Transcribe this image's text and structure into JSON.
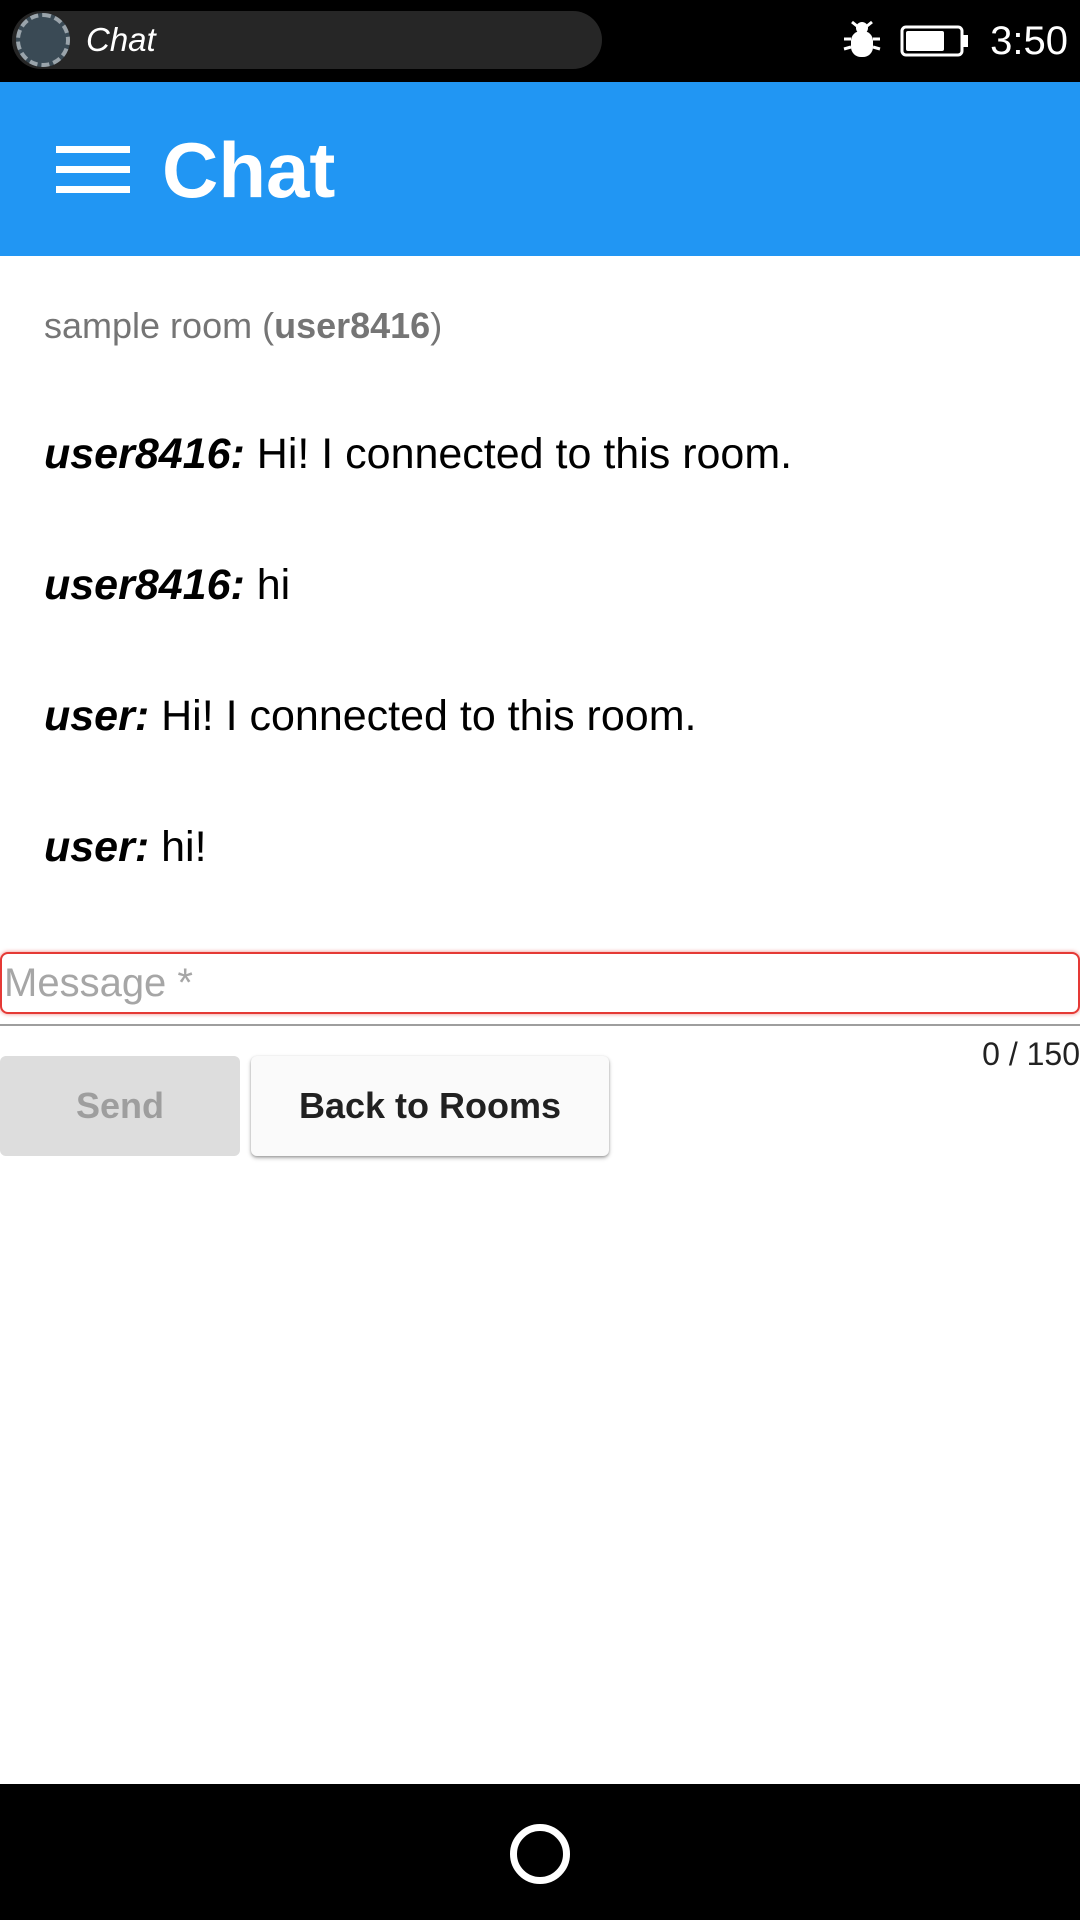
{
  "status_bar": {
    "notification_title": "Chat",
    "clock": "3:50",
    "icons": [
      "avatar-icon",
      "bug-icon",
      "battery-icon"
    ]
  },
  "app_bar": {
    "title": "Chat",
    "menu_icon": "menu-icon",
    "color": "#2196f3"
  },
  "room": {
    "name": "sample room",
    "user": "user8416"
  },
  "messages": [
    {
      "author": "user8416:",
      "text": " Hi! I connected to this room."
    },
    {
      "author": "user8416:",
      "text": " hi"
    },
    {
      "author": "user:",
      "text": " Hi! I connected to this room."
    },
    {
      "author": "user:",
      "text": " hi!"
    }
  ],
  "input": {
    "placeholder": "Message *",
    "value": "",
    "counter": "0 / 150"
  },
  "buttons": {
    "send": "Send",
    "back": "Back to Rooms"
  },
  "nav_bar": {
    "home_icon": "home-circle-icon"
  }
}
